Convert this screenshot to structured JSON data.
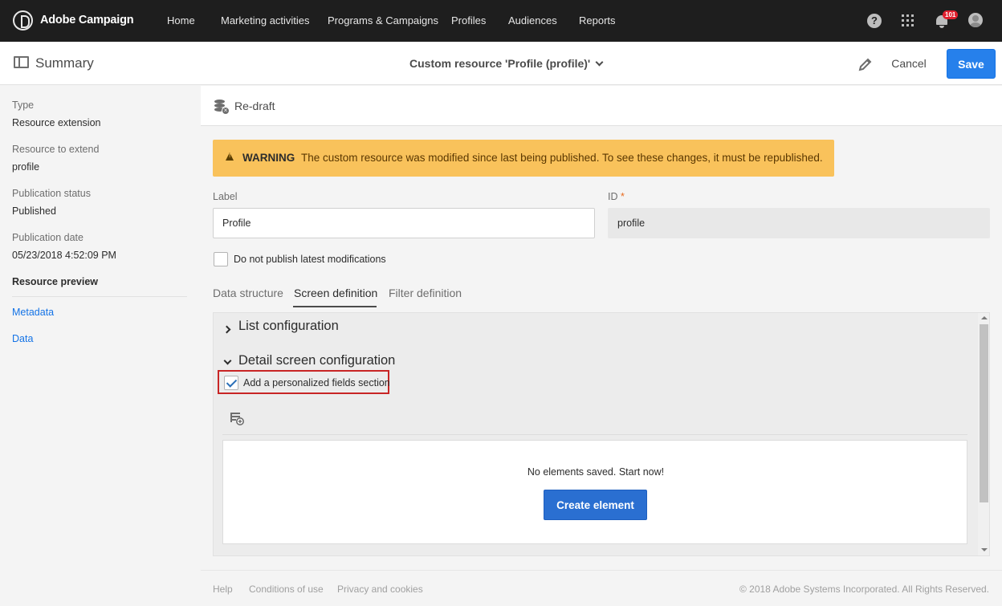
{
  "app": {
    "brand": "Adobe Campaign",
    "nav": [
      "Home",
      "Marketing activities",
      "Programs & Campaigns",
      "Profiles",
      "Audiences",
      "Reports"
    ],
    "help_glyph": "?",
    "notifications_count": "101",
    "icons": [
      "adobe-campaign-logo-icon",
      "help-icon",
      "apps-grid-icon",
      "bell-icon",
      "avatar-icon"
    ]
  },
  "actionbar": {
    "summary_label": "Summary",
    "resource_title": "Custom resource 'Profile (profile)'",
    "cancel_label": "Cancel",
    "save_label": "Save",
    "save_color": "#2680eb"
  },
  "sidebar": {
    "type_label": "Type",
    "type_value": "Resource extension",
    "extend_label": "Resource to extend",
    "extend_value": "profile",
    "status_label": "Publication status",
    "status_value": "Published",
    "date_label": "Publication date",
    "date_value": "05/23/2018 4:52:09 PM",
    "preview_heading": "Resource preview",
    "links": [
      "Metadata",
      "Data"
    ]
  },
  "main": {
    "redraft_label": "Re-draft",
    "warning_title": "WARNING",
    "warning_text": "The custom resource was modified since last being published. To see these changes, it must be republished.",
    "warning_color": "#f9c25b",
    "label_field_label": "Label",
    "label_field_value": "Profile",
    "id_field_label": "ID",
    "id_required_mark": "*",
    "id_field_value": "profile",
    "no_publish_label": "Do not publish latest modifications",
    "tabs": [
      "Data structure",
      "Screen definition",
      "Filter definition"
    ],
    "active_tab": "Screen definition",
    "list_config_title": "List configuration",
    "detail_config_title": "Detail screen configuration",
    "personalized_checkbox_label": "Add a personalized fields section",
    "personalized_checked": true,
    "empty_text": "No elements saved. Start now!",
    "create_label": "Create element",
    "highlight_color": "#c82525"
  },
  "footer": {
    "links": [
      "Help",
      "Conditions of use",
      "Privacy and cookies"
    ],
    "copyright": "© 2018 Adobe Systems Incorporated. All Rights Reserved."
  }
}
